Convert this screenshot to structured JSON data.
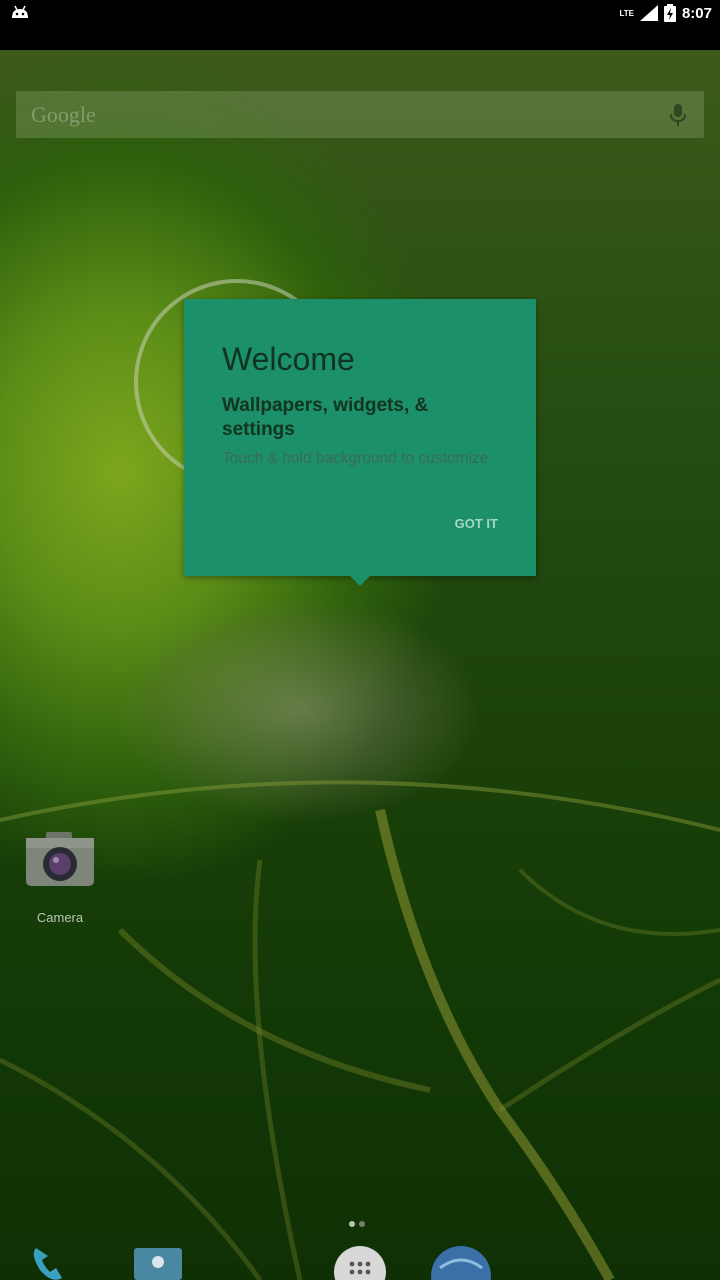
{
  "status_bar": {
    "time": "8:07",
    "network": "LTE",
    "icons": [
      "android-notification-icon",
      "signal-icon",
      "battery-charging-icon"
    ]
  },
  "search_bar": {
    "placeholder": "Google",
    "icons": [
      "mic-icon"
    ]
  },
  "welcome_dialog": {
    "title": "Welcome",
    "subtitle": "Wallpapers, widgets, & settings",
    "body": "Touch & hold background to customize",
    "button": "GOT IT",
    "background_color": "#1c8f6b"
  },
  "home_screen": {
    "shortcuts": [
      {
        "label": "Camera",
        "icon": "camera-icon"
      }
    ],
    "page_indicator": {
      "pages": 2,
      "active": 0
    },
    "dock": [
      {
        "icon": "phone-icon"
      },
      {
        "icon": "contacts-icon"
      },
      {
        "icon": "app-drawer-icon"
      },
      {
        "icon": "browser-icon"
      }
    ]
  }
}
